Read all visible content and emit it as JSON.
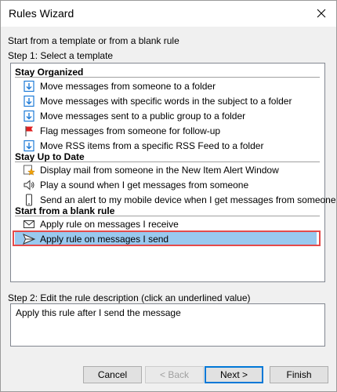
{
  "window": {
    "title": "Rules Wizard",
    "close_icon": "close-icon"
  },
  "intro_text": "Start from a template or from a blank rule",
  "step1_label": "Step 1: Select a template",
  "groups": [
    {
      "name": "Stay Organized",
      "items": [
        {
          "label": "Move messages from someone to a folder",
          "icon": "folder-move-icon"
        },
        {
          "label": "Move messages with specific words in the subject to a folder",
          "icon": "folder-move-icon"
        },
        {
          "label": "Move messages sent to a public group to a folder",
          "icon": "folder-move-icon"
        },
        {
          "label": "Flag messages from someone for follow-up",
          "icon": "red-flag-icon"
        },
        {
          "label": "Move RSS items from a specific RSS Feed to a folder",
          "icon": "folder-move-icon"
        }
      ]
    },
    {
      "name": "Stay Up to Date",
      "items": [
        {
          "label": "Display mail from someone in the New Item Alert Window",
          "icon": "new-item-alert-icon"
        },
        {
          "label": "Play a sound when I get messages from someone",
          "icon": "speaker-icon"
        },
        {
          "label": "Send an alert to my mobile device when I get messages from someone",
          "icon": "mobile-device-icon"
        }
      ]
    },
    {
      "name": "Start from a blank rule",
      "items": [
        {
          "label": "Apply rule on messages I receive",
          "icon": "envelope-icon"
        },
        {
          "label": "Apply rule on messages I send",
          "icon": "send-icon",
          "selected": true
        }
      ]
    }
  ],
  "step2_label": "Step 2: Edit the rule description (click an underlined value)",
  "rule_description": "Apply this rule after I send the message",
  "buttons": {
    "cancel": "Cancel",
    "back": "< Back",
    "next": "Next >",
    "finish": "Finish"
  },
  "colors": {
    "selection": "#99c9ef",
    "highlight_border": "#e54b4b",
    "folder_blue": "#1e7bd7",
    "flag_red": "#e02020"
  }
}
